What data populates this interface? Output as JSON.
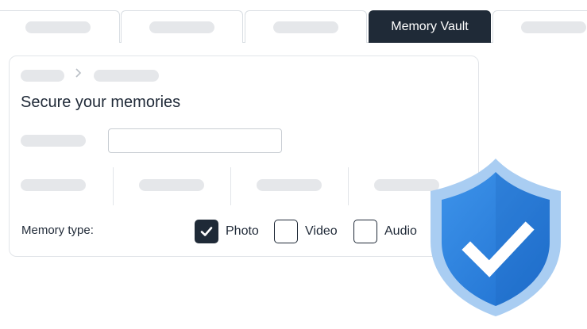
{
  "tabs": [
    {
      "label": "",
      "placeholder": true
    },
    {
      "label": "",
      "placeholder": true
    },
    {
      "label": "",
      "placeholder": true
    },
    {
      "label": "Memory Vault",
      "active": true
    },
    {
      "label": "",
      "placeholder": true
    }
  ],
  "card": {
    "title": "Secure your memories",
    "memory_type_label": "Memory type:",
    "options": [
      {
        "label": "Photo",
        "checked": true
      },
      {
        "label": "Video",
        "checked": false
      },
      {
        "label": "Audio",
        "checked": false
      }
    ]
  },
  "colors": {
    "dark": "#1f2a37",
    "placeholder": "#e5e7ea",
    "shield_blue": "#2f86e0",
    "shield_light": "#a9cdf2"
  },
  "icons": {
    "breadcrumb_separator": "chevron-right-icon",
    "check": "checkmark-icon",
    "badge": "shield-check-icon"
  }
}
